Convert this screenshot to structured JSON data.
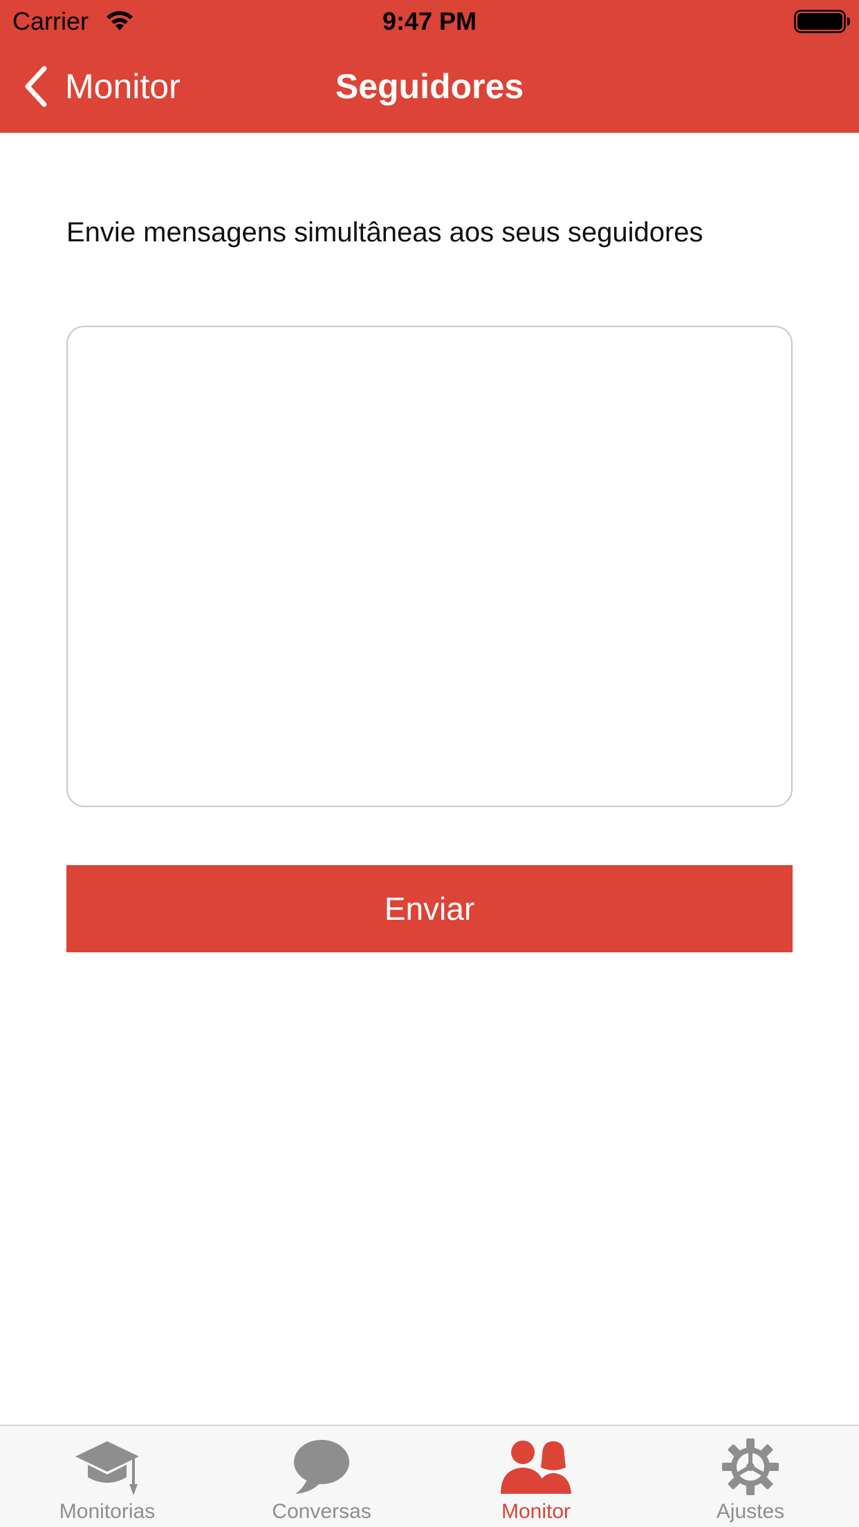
{
  "status_bar": {
    "carrier": "Carrier",
    "time": "9:47 PM",
    "wifi_icon": "wifi-icon",
    "battery_icon": "battery-full-icon"
  },
  "nav": {
    "back_label": "Monitor",
    "back_icon": "chevron-left-icon",
    "title": "Seguidores"
  },
  "content": {
    "instruction": "Envie mensagens simultâneas aos seus seguidores",
    "message_value": "",
    "send_label": "Enviar"
  },
  "tab_bar": {
    "tabs": [
      {
        "label": "Monitorias",
        "icon": "graduation-cap-icon",
        "active": false
      },
      {
        "label": "Conversas",
        "icon": "chat-bubble-icon",
        "active": false
      },
      {
        "label": "Monitor",
        "icon": "people-icon",
        "active": true
      },
      {
        "label": "Ajustes",
        "icon": "gear-icon",
        "active": false
      }
    ]
  },
  "colors": {
    "brand": "#DB4437",
    "tab_inactive": "#8E8E8E",
    "tab_bar_background": "#F7F7F7"
  }
}
